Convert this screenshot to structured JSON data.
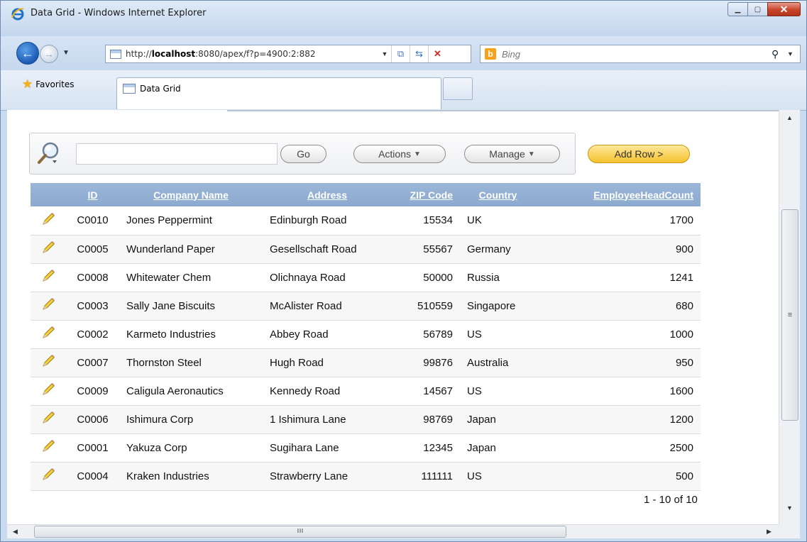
{
  "window": {
    "title": "Data Grid - Windows Internet Explorer"
  },
  "address_bar": {
    "url_prefix": "http://",
    "url_host": "localhost",
    "url_rest": ":8080/apex/f?p=4900:2:882",
    "search_placeholder": "Bing"
  },
  "favorites_bar": {
    "favorites_label": "Favorites",
    "tab_label": "Data Grid"
  },
  "search_region": {
    "query": "",
    "go_label": "Go",
    "actions_label": "Actions",
    "manage_label": "Manage",
    "add_row_label": "Add Row >"
  },
  "grid": {
    "columns": [
      "ID",
      "Company Name",
      "Address",
      "ZIP Code",
      "Country",
      "EmployeeHeadCount"
    ],
    "rows": [
      {
        "id": "C0010",
        "company": "Jones Peppermint",
        "address": "Edinburgh Road",
        "zip": "15534",
        "country": "UK",
        "headcount": "1700"
      },
      {
        "id": "C0005",
        "company": "Wunderland Paper",
        "address": "Gesellschaft Road",
        "zip": "55567",
        "country": "Germany",
        "headcount": "900"
      },
      {
        "id": "C0008",
        "company": "Whitewater Chem",
        "address": "Olichnaya Road",
        "zip": "50000",
        "country": "Russia",
        "headcount": "1241"
      },
      {
        "id": "C0003",
        "company": "Sally Jane Biscuits",
        "address": "McAlister Road",
        "zip": "510559",
        "country": "Singapore",
        "headcount": "680"
      },
      {
        "id": "C0002",
        "company": "Karmeto Industries",
        "address": "Abbey Road",
        "zip": "56789",
        "country": "US",
        "headcount": "1000"
      },
      {
        "id": "C0007",
        "company": "Thornston Steel",
        "address": "Hugh Road",
        "zip": "99876",
        "country": "Australia",
        "headcount": "950"
      },
      {
        "id": "C0009",
        "company": "Caligula Aeronautics",
        "address": "Kennedy Road",
        "zip": "14567",
        "country": "US",
        "headcount": "1600"
      },
      {
        "id": "C0006",
        "company": "Ishimura Corp",
        "address": "1 Ishimura Lane",
        "zip": "98769",
        "country": "Japan",
        "headcount": "1200"
      },
      {
        "id": "C0001",
        "company": "Yakuza Corp",
        "address": "Sugihara Lane",
        "zip": "12345",
        "country": "Japan",
        "headcount": "2500"
      },
      {
        "id": "C0004",
        "company": "Kraken Industries",
        "address": "Strawberry Lane",
        "zip": "111111",
        "country": "US",
        "headcount": "500"
      }
    ],
    "pagination": "1 - 10 of 10"
  },
  "icons": {
    "browser": "ie-logo-icon",
    "edit": "pencil-icon",
    "search": "magnifier-icon"
  }
}
